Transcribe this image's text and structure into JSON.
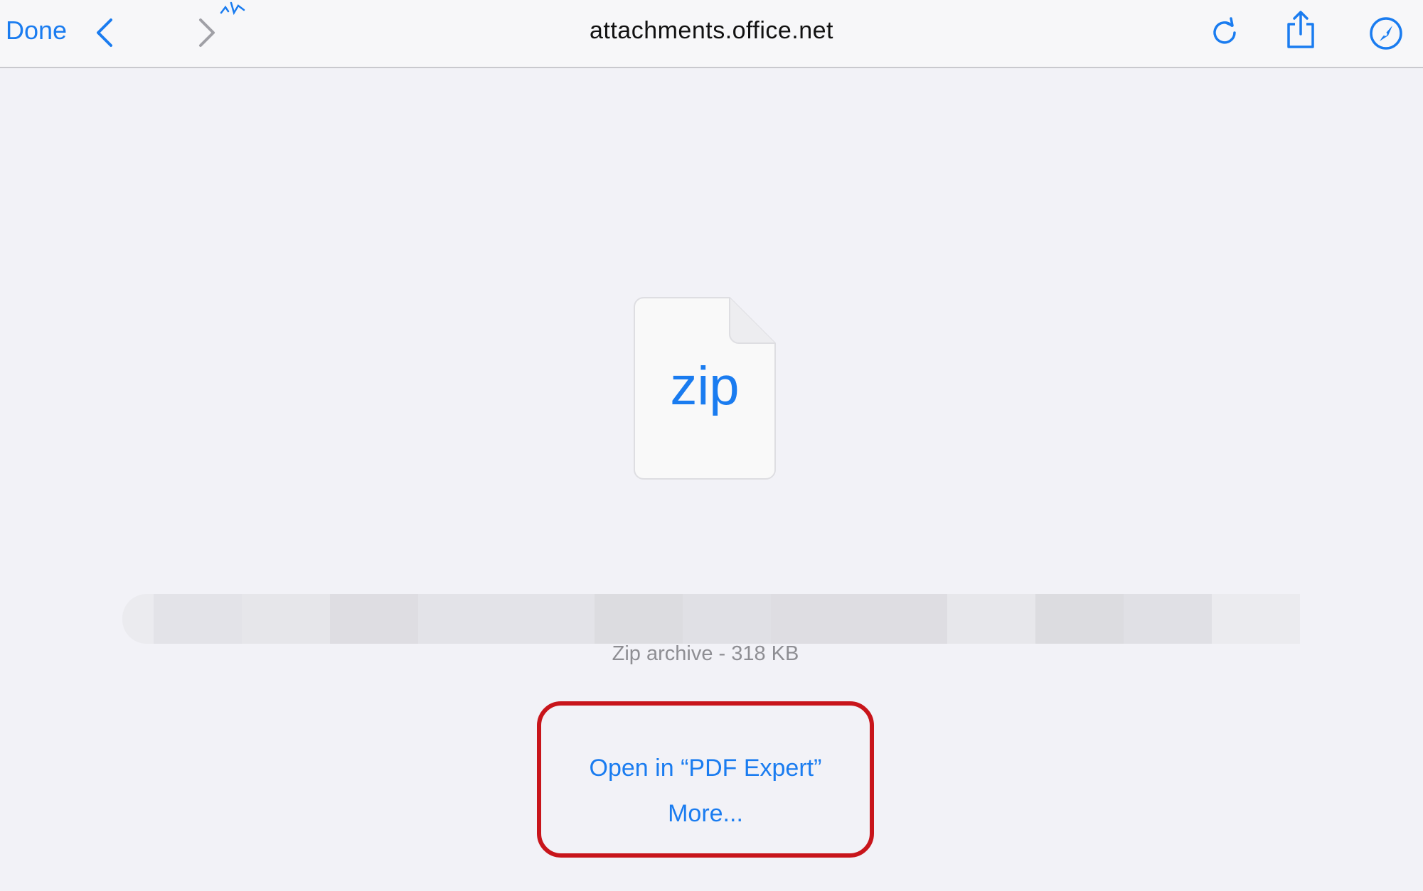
{
  "toolbar": {
    "done_label": "Done",
    "url": "attachments.office.net",
    "icons": {
      "back": "chevron-left-icon",
      "forward": "chevron-right-icon",
      "reload": "reload-icon",
      "share": "share-icon",
      "compass": "compass-icon"
    },
    "accent_color": "#1a7cf0",
    "disabled_color": "#a0a0a6"
  },
  "file": {
    "extension": "zip",
    "meta": "Zip archive - 318 KB",
    "name_redacted": true
  },
  "actions": {
    "open_in": "Open in “PDF Expert”",
    "more": "More..."
  },
  "colors": {
    "background": "#f2f2f7",
    "highlight_border": "#c8151b"
  }
}
